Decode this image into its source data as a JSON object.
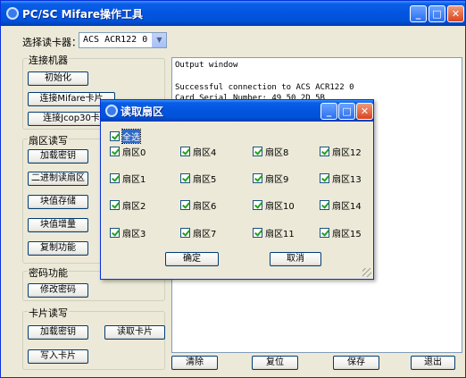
{
  "window": {
    "title": "PC/SC Mifare操作工具",
    "min": "_",
    "max": "□",
    "close": "✕"
  },
  "reader": {
    "label": "选择读卡器：",
    "value": "ACS ACR122 0"
  },
  "groups": {
    "connect": {
      "title": "连接机器",
      "buttons": [
        "初始化",
        "连接Mifare卡片",
        "连接Jcop30卡"
      ]
    },
    "sector": {
      "title": "扇区读写",
      "buttons": [
        "加载密钥",
        "二进制读扇区",
        "块值存储",
        "块值增量",
        "复制功能"
      ]
    },
    "password": {
      "title": "密码功能",
      "buttons": [
        "修改密码"
      ]
    },
    "card": {
      "title": "卡片读写",
      "buttons": [
        "加载密钥",
        "读取卡片",
        "写入卡片"
      ]
    }
  },
  "output": {
    "lines": [
      "Output window",
      "",
      "Successful connection to ACS ACR122 0",
      "Card Serial Number: 49 50 2D 5B"
    ]
  },
  "bottom": [
    "清除",
    "复位",
    "保存",
    "退出"
  ],
  "dialog": {
    "title": "读取扇区",
    "select_all": "全选",
    "sectors": [
      "扇区0",
      "扇区1",
      "扇区2",
      "扇区3",
      "扇区4",
      "扇区5",
      "扇区6",
      "扇区7",
      "扇区8",
      "扇区9",
      "扇区10",
      "扇区11",
      "扇区12",
      "扇区13",
      "扇区14",
      "扇区15"
    ],
    "ok": "确定",
    "cancel": "取消"
  },
  "colors": {
    "titlebar": "#0355e0",
    "face": "#ece9d8",
    "check": "#21a121"
  },
  "icons": [
    "app-icon",
    "minimize-icon",
    "maximize-icon",
    "close-icon",
    "dropdown-arrow-icon",
    "checkmark-icon",
    "resize-grip-icon"
  ]
}
